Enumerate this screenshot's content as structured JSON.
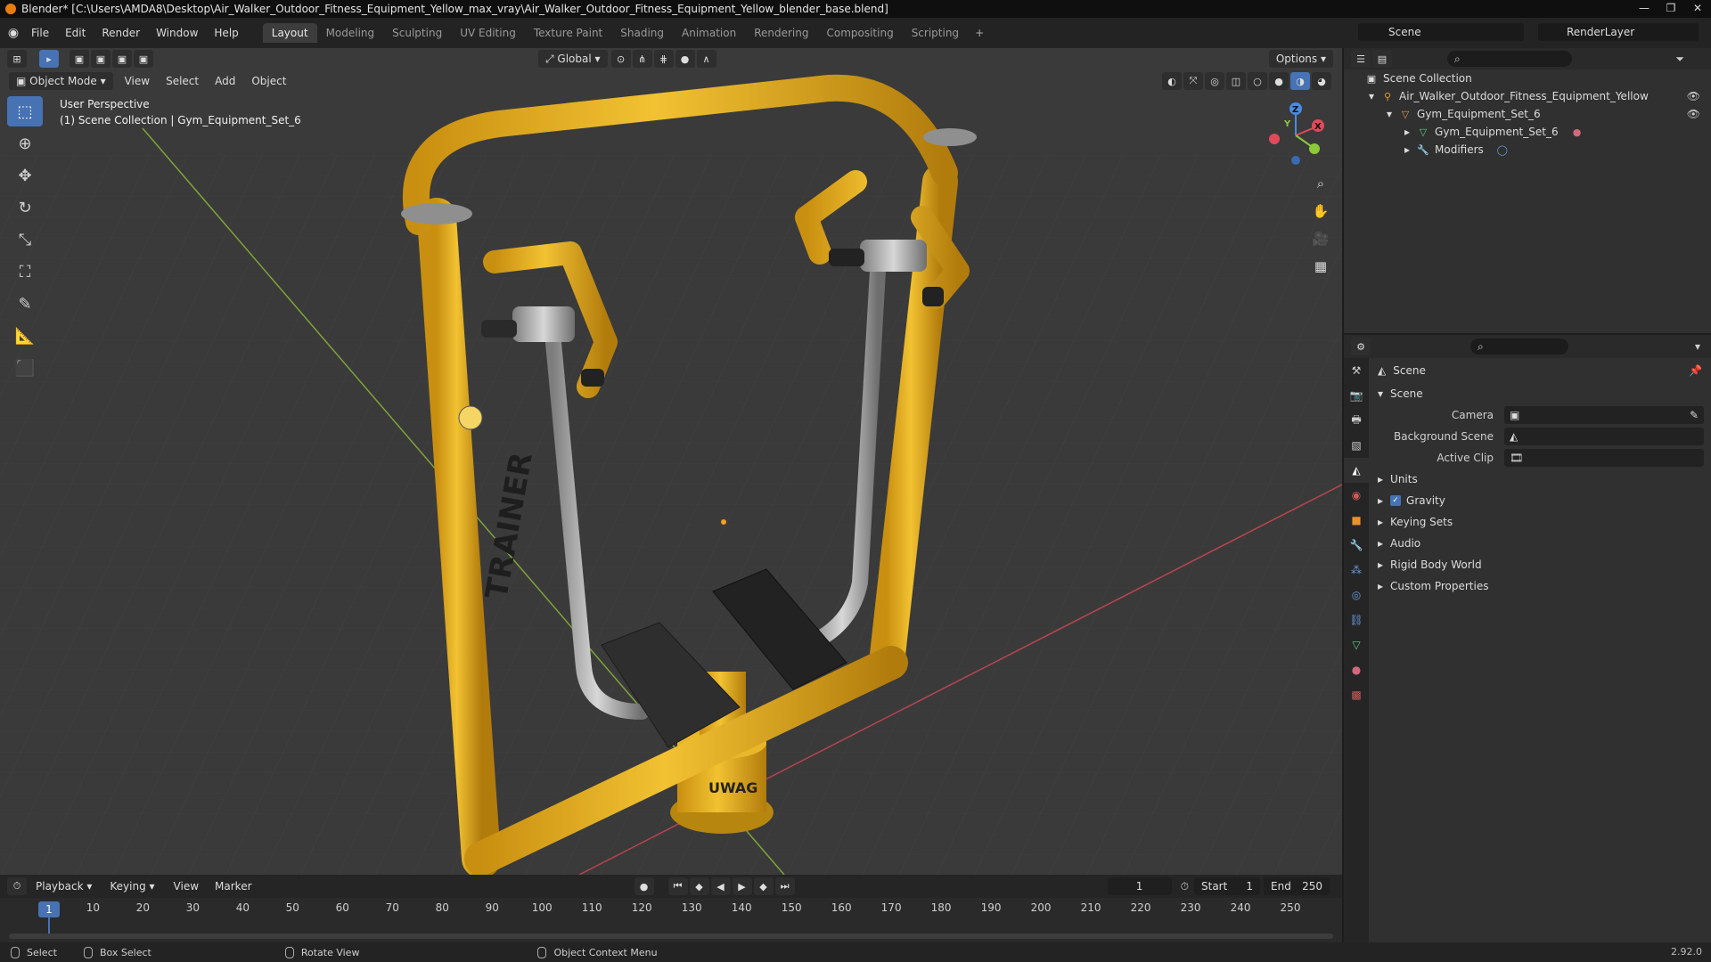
{
  "window": {
    "title": "Blender* [C:\\Users\\AMDA8\\Desktop\\Air_Walker_Outdoor_Fitness_Equipment_Yellow_max_vray\\Air_Walker_Outdoor_Fitness_Equipment_Yellow_blender_base.blend]"
  },
  "menu": {
    "file": "File",
    "edit": "Edit",
    "render": "Render",
    "window": "Window",
    "help": "Help"
  },
  "workspaces": [
    "Layout",
    "Modeling",
    "Sculpting",
    "UV Editing",
    "Texture Paint",
    "Shading",
    "Animation",
    "Rendering",
    "Compositing",
    "Scripting"
  ],
  "workspace_add": "+",
  "header": {
    "scene": "Scene",
    "render_layer": "RenderLayer",
    "transform_orientation": "Global",
    "options": "Options"
  },
  "viewport": {
    "mode": "Object Mode",
    "view": "View",
    "select": "Select",
    "add": "Add",
    "object": "Object",
    "perspective": "User Perspective",
    "collection_info": "(1) Scene Collection | Gym_Equipment_Set_6",
    "frame_label": "TRAINER",
    "base_label": "UWAG"
  },
  "gizmo": {
    "x": "X",
    "y": "Y",
    "z": "Z"
  },
  "outliner": {
    "root": "Scene Collection",
    "items": [
      {
        "label": "Air_Walker_Outdoor_Fitness_Equipment_Yellow",
        "depth": 1
      },
      {
        "label": "Gym_Equipment_Set_6",
        "depth": 2
      },
      {
        "label": "Gym_Equipment_Set_6",
        "depth": 3
      },
      {
        "label": "Modifiers",
        "depth": 3
      }
    ]
  },
  "properties": {
    "context": "Scene",
    "panel": "Scene",
    "fields": {
      "camera": "Camera",
      "background_scene": "Background Scene",
      "active_clip": "Active Clip"
    },
    "sections": [
      "Units",
      "Gravity",
      "Keying Sets",
      "Audio",
      "Rigid Body World",
      "Custom Properties"
    ]
  },
  "timeline": {
    "playback": "Playback",
    "keying": "Keying",
    "view": "View",
    "marker": "Marker",
    "current_frame": "1",
    "start_label": "Start",
    "start": "1",
    "end_label": "End",
    "end": "250",
    "ticks": [
      "10",
      "20",
      "30",
      "40",
      "50",
      "60",
      "70",
      "80",
      "90",
      "100",
      "110",
      "120",
      "130",
      "140",
      "150",
      "160",
      "170",
      "180",
      "190",
      "200",
      "210",
      "220",
      "230",
      "240",
      "250"
    ],
    "marker_frame": "1"
  },
  "status": {
    "select": "Select",
    "box_select": "Box Select",
    "rotate_view": "Rotate View",
    "context_menu": "Object Context Menu",
    "version": "2.92.0"
  },
  "colors": {
    "accent": "#4772b3",
    "equipment_yellow": "#e8b21e",
    "x_axis": "#e04a5a",
    "y_axis": "#8bc83a",
    "z_axis": "#4a8be0"
  }
}
